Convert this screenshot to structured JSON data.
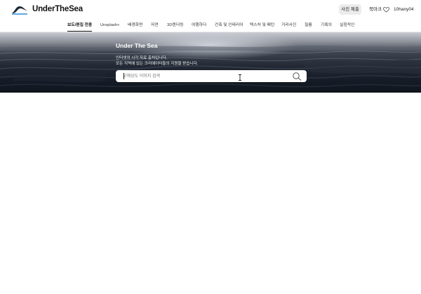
{
  "header": {
    "brand": "UnderTheSea",
    "submit_button": "사진 제출",
    "bookmark": "북마크",
    "user": "10hany04"
  },
  "nav": {
    "items": [
      {
        "label": "보도/편집 전용",
        "active": true
      },
      {
        "label": "Unsplash+"
      },
      {
        "label": "배경화면"
      },
      {
        "label": "자연"
      },
      {
        "label": "3D렌더링"
      },
      {
        "label": "여행하다"
      },
      {
        "label": "건축 및 인테리어"
      },
      {
        "label": "텍스처 및 패턴"
      },
      {
        "label": "거리사진"
      },
      {
        "label": "필름"
      },
      {
        "label": "기록의"
      },
      {
        "label": "실험적인"
      }
    ]
  },
  "hero": {
    "title": "Under The Sea",
    "line1": "인터넷의 시각 자료 출처입니다.",
    "line2": "모든 지역에 있는 크리에이터들의 지원을 받습니다.",
    "search_placeholder": "고해상도 이미지 검색"
  },
  "colors": {
    "nav_active": "#111111",
    "submit_bg": "#ececec",
    "hero_dark": "#161c27"
  },
  "icons": [
    "logo-icon",
    "heart-icon",
    "search-icon",
    "text-cursor-icon"
  ]
}
